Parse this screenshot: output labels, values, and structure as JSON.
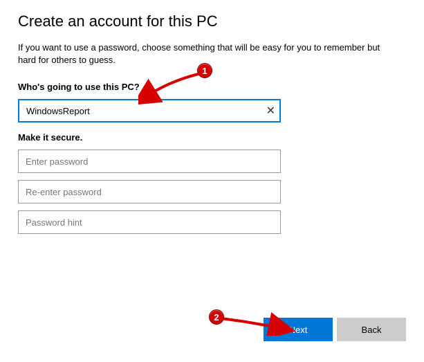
{
  "title": "Create an account for this PC",
  "subtitle": "If you want to use a password, choose something that will be easy for you to remember but hard for others to guess.",
  "section1": {
    "label": "Who's going to use this PC?",
    "username_value": "WindowsReport"
  },
  "section2": {
    "label": "Make it secure.",
    "password_placeholder": "Enter password",
    "reenter_placeholder": "Re-enter password",
    "hint_placeholder": "Password hint"
  },
  "buttons": {
    "next": "Next",
    "back": "Back"
  },
  "annotations": {
    "badge1": "1",
    "badge2": "2"
  }
}
